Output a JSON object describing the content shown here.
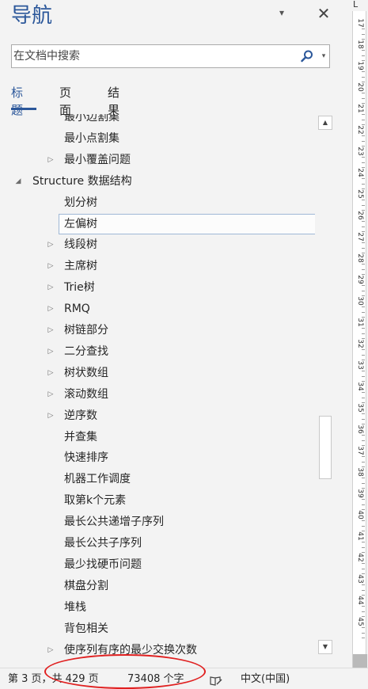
{
  "nav": {
    "title": "导航",
    "options_glyph": "▾",
    "close_glyph": "✕"
  },
  "search": {
    "placeholder": "在文档中搜索",
    "value": "",
    "dropdown_glyph": "▾"
  },
  "tabs": [
    {
      "label": "标题",
      "active": true
    },
    {
      "label": "页面",
      "active": false
    },
    {
      "label": "结果",
      "active": false
    }
  ],
  "tree": {
    "items": [
      {
        "label": "最小边割集",
        "level": 2,
        "arrow": ""
      },
      {
        "label": "最小点割集",
        "level": 2,
        "arrow": ""
      },
      {
        "label": "最小覆盖问题",
        "level": 2,
        "arrow": "collapsed"
      },
      {
        "label": "Structure 数据结构",
        "level": 1,
        "arrow": "expanded"
      },
      {
        "label": "划分树",
        "level": 2,
        "arrow": ""
      },
      {
        "label": "左偏树",
        "level": 2,
        "arrow": "",
        "selected": true
      },
      {
        "label": "线段树",
        "level": 2,
        "arrow": "collapsed"
      },
      {
        "label": "主席树",
        "level": 2,
        "arrow": "collapsed"
      },
      {
        "label": "Trie树",
        "level": 2,
        "arrow": "collapsed"
      },
      {
        "label": "RMQ",
        "level": 2,
        "arrow": "collapsed"
      },
      {
        "label": "树链部分",
        "level": 2,
        "arrow": "collapsed"
      },
      {
        "label": "二分查找",
        "level": 2,
        "arrow": "collapsed"
      },
      {
        "label": "树状数组",
        "level": 2,
        "arrow": "collapsed"
      },
      {
        "label": "滚动数组",
        "level": 2,
        "arrow": "collapsed"
      },
      {
        "label": "逆序数",
        "level": 2,
        "arrow": "collapsed"
      },
      {
        "label": "并查集",
        "level": 2,
        "arrow": ""
      },
      {
        "label": "快速排序",
        "level": 2,
        "arrow": ""
      },
      {
        "label": "机器工作调度",
        "level": 2,
        "arrow": ""
      },
      {
        "label": "取第k个元素",
        "level": 2,
        "arrow": ""
      },
      {
        "label": "最长公共递增子序列",
        "level": 2,
        "arrow": ""
      },
      {
        "label": "最长公共子序列",
        "level": 2,
        "arrow": ""
      },
      {
        "label": "最少找硬币问题",
        "level": 2,
        "arrow": ""
      },
      {
        "label": "棋盘分割",
        "level": 2,
        "arrow": ""
      },
      {
        "label": "堆栈",
        "level": 2,
        "arrow": ""
      },
      {
        "label": "背包相关",
        "level": 2,
        "arrow": ""
      },
      {
        "label": "使序列有序的最少交换次数",
        "level": 2,
        "arrow": "collapsed"
      }
    ]
  },
  "scrollbar": {
    "up_glyph": "▲",
    "down_glyph": "▼",
    "thumb_position_fraction": 0.64
  },
  "ruler": {
    "corner_glyph": "L",
    "numbers": [
      "17",
      "18",
      "19",
      "20",
      "21",
      "22",
      "23",
      "24",
      "25",
      "26",
      "27",
      "28",
      "29",
      "30",
      "31",
      "32",
      "33",
      "34",
      "35",
      "36",
      "37",
      "38",
      "39",
      "40",
      "41",
      "42",
      "43",
      "44",
      "45"
    ],
    "current": "45"
  },
  "status": {
    "page": "第 3 页，共 429 页",
    "words": "73408 个字",
    "language": "中文(中国)",
    "highlight_color": "#e02020"
  },
  "colors": {
    "accent": "#2b579a",
    "pane_bg": "#f3f3f3"
  }
}
